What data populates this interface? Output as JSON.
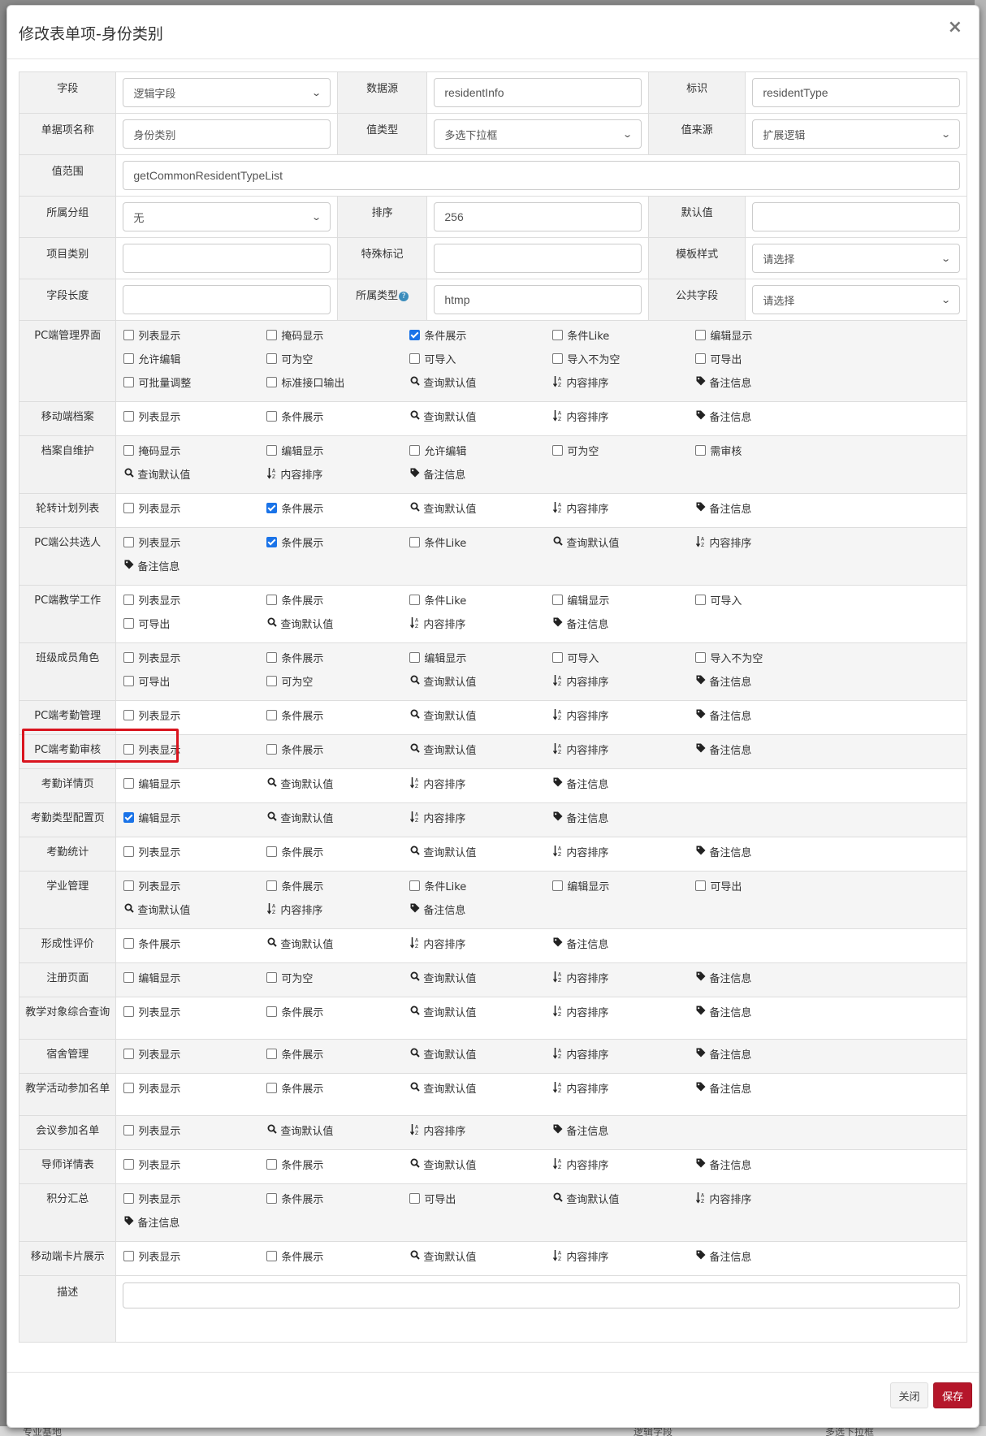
{
  "modal": {
    "title": "修改表单项-身份类别",
    "close_glyph": "×"
  },
  "form": {
    "field": {
      "label": "字段",
      "value": "逻辑字段"
    },
    "datasource": {
      "label": "数据源",
      "value": "residentInfo"
    },
    "identifier": {
      "label": "标识",
      "value": "residentType"
    },
    "item_name": {
      "label": "单据项名称",
      "value": "身份类别"
    },
    "value_type": {
      "label": "值类型",
      "value": "多选下拉框"
    },
    "value_source": {
      "label": "值来源",
      "value": "扩展逻辑"
    },
    "value_range": {
      "label": "值范围",
      "value": "getCommonResidentTypeList"
    },
    "group": {
      "label": "所属分组",
      "value": "无"
    },
    "sort": {
      "label": "排序",
      "value": "256"
    },
    "default": {
      "label": "默认值",
      "value": ""
    },
    "project_type": {
      "label": "项目类别",
      "value": ""
    },
    "special_mark": {
      "label": "特殊标记",
      "value": ""
    },
    "template_style": {
      "label": "模板样式",
      "value": "请选择"
    },
    "field_length": {
      "label": "字段长度",
      "value": ""
    },
    "belong_type": {
      "label": "所属类型",
      "value": "htmp",
      "help": "?"
    },
    "public_field": {
      "label": "公共字段",
      "value": "请选择"
    },
    "description": {
      "label": "描述",
      "value": ""
    }
  },
  "sections": [
    {
      "label": "PC端管理界面",
      "items": [
        {
          "type": "checkbox",
          "label": "列表显示",
          "checked": false
        },
        {
          "type": "checkbox",
          "label": "掩码显示",
          "checked": false
        },
        {
          "type": "checkbox",
          "label": "条件展示",
          "checked": true
        },
        {
          "type": "checkbox",
          "label": "条件Like",
          "checked": false
        },
        {
          "type": "checkbox",
          "label": "编辑显示",
          "checked": false
        },
        {
          "type": "checkbox",
          "label": "允许编辑",
          "checked": false
        },
        {
          "type": "checkbox",
          "label": "可为空",
          "checked": false
        },
        {
          "type": "checkbox",
          "label": "可导入",
          "checked": false
        },
        {
          "type": "checkbox",
          "label": "导入不为空",
          "checked": false
        },
        {
          "type": "checkbox",
          "label": "可导出",
          "checked": false
        },
        {
          "type": "checkbox",
          "label": "可批量调整",
          "checked": false
        },
        {
          "type": "checkbox",
          "label": "标准接口输出",
          "checked": false
        },
        {
          "type": "search",
          "label": "查询默认值"
        },
        {
          "type": "sort",
          "label": "内容排序"
        },
        {
          "type": "tag",
          "label": "备注信息"
        }
      ]
    },
    {
      "label": "移动端档案",
      "items": [
        {
          "type": "checkbox",
          "label": "列表显示",
          "checked": false
        },
        {
          "type": "checkbox",
          "label": "条件展示",
          "checked": false
        },
        {
          "type": "search",
          "label": "查询默认值"
        },
        {
          "type": "sort",
          "label": "内容排序"
        },
        {
          "type": "tag",
          "label": "备注信息"
        }
      ]
    },
    {
      "label": "档案自维护",
      "items": [
        {
          "type": "checkbox",
          "label": "掩码显示",
          "checked": false
        },
        {
          "type": "checkbox",
          "label": "编辑显示",
          "checked": false
        },
        {
          "type": "checkbox",
          "label": "允许编辑",
          "checked": false
        },
        {
          "type": "checkbox",
          "label": "可为空",
          "checked": false
        },
        {
          "type": "checkbox",
          "label": "需审核",
          "checked": false
        },
        {
          "type": "search",
          "label": "查询默认值"
        },
        {
          "type": "sort",
          "label": "内容排序"
        },
        {
          "type": "tag",
          "label": "备注信息"
        }
      ]
    },
    {
      "label": "轮转计划列表",
      "items": [
        {
          "type": "checkbox",
          "label": "列表显示",
          "checked": false
        },
        {
          "type": "checkbox",
          "label": "条件展示",
          "checked": true
        },
        {
          "type": "search",
          "label": "查询默认值"
        },
        {
          "type": "sort",
          "label": "内容排序"
        },
        {
          "type": "tag",
          "label": "备注信息"
        }
      ]
    },
    {
      "label": "PC端公共选人",
      "items": [
        {
          "type": "checkbox",
          "label": "列表显示",
          "checked": false
        },
        {
          "type": "checkbox",
          "label": "条件展示",
          "checked": true
        },
        {
          "type": "checkbox",
          "label": "条件Like",
          "checked": false
        },
        {
          "type": "search",
          "label": "查询默认值"
        },
        {
          "type": "sort",
          "label": "内容排序"
        },
        {
          "type": "tag",
          "label": "备注信息"
        }
      ]
    },
    {
      "label": "PC端教学工作",
      "items": [
        {
          "type": "checkbox",
          "label": "列表显示",
          "checked": false
        },
        {
          "type": "checkbox",
          "label": "条件展示",
          "checked": false
        },
        {
          "type": "checkbox",
          "label": "条件Like",
          "checked": false
        },
        {
          "type": "checkbox",
          "label": "编辑显示",
          "checked": false
        },
        {
          "type": "checkbox",
          "label": "可导入",
          "checked": false
        },
        {
          "type": "checkbox",
          "label": "可导出",
          "checked": false
        },
        {
          "type": "search",
          "label": "查询默认值"
        },
        {
          "type": "sort",
          "label": "内容排序"
        },
        {
          "type": "tag",
          "label": "备注信息"
        }
      ]
    },
    {
      "label": "班级成员角色",
      "items": [
        {
          "type": "checkbox",
          "label": "列表显示",
          "checked": false
        },
        {
          "type": "checkbox",
          "label": "条件展示",
          "checked": false
        },
        {
          "type": "checkbox",
          "label": "编辑显示",
          "checked": false
        },
        {
          "type": "checkbox",
          "label": "可导入",
          "checked": false
        },
        {
          "type": "checkbox",
          "label": "导入不为空",
          "checked": false
        },
        {
          "type": "checkbox",
          "label": "可导出",
          "checked": false
        },
        {
          "type": "checkbox",
          "label": "可为空",
          "checked": false
        },
        {
          "type": "search",
          "label": "查询默认值"
        },
        {
          "type": "sort",
          "label": "内容排序"
        },
        {
          "type": "tag",
          "label": "备注信息"
        }
      ]
    },
    {
      "label": "PC端考勤管理",
      "items": [
        {
          "type": "checkbox",
          "label": "列表显示",
          "checked": false
        },
        {
          "type": "checkbox",
          "label": "条件展示",
          "checked": false
        },
        {
          "type": "search",
          "label": "查询默认值"
        },
        {
          "type": "sort",
          "label": "内容排序"
        },
        {
          "type": "tag",
          "label": "备注信息"
        }
      ]
    },
    {
      "label": "PC端考勤审核",
      "items": [
        {
          "type": "checkbox",
          "label": "列表显示",
          "checked": false
        },
        {
          "type": "checkbox",
          "label": "条件展示",
          "checked": false
        },
        {
          "type": "search",
          "label": "查询默认值"
        },
        {
          "type": "sort",
          "label": "内容排序"
        },
        {
          "type": "tag",
          "label": "备注信息"
        }
      ]
    },
    {
      "label": "考勤详情页",
      "items": [
        {
          "type": "checkbox",
          "label": "编辑显示",
          "checked": false
        },
        {
          "type": "search",
          "label": "查询默认值"
        },
        {
          "type": "sort",
          "label": "内容排序"
        },
        {
          "type": "tag",
          "label": "备注信息"
        }
      ]
    },
    {
      "label": "考勤类型配置页",
      "highlight": true,
      "items": [
        {
          "type": "checkbox",
          "label": "编辑显示",
          "checked": true
        },
        {
          "type": "search",
          "label": "查询默认值"
        },
        {
          "type": "sort",
          "label": "内容排序"
        },
        {
          "type": "tag",
          "label": "备注信息"
        }
      ]
    },
    {
      "label": "考勤统计",
      "items": [
        {
          "type": "checkbox",
          "label": "列表显示",
          "checked": false
        },
        {
          "type": "checkbox",
          "label": "条件展示",
          "checked": false
        },
        {
          "type": "search",
          "label": "查询默认值"
        },
        {
          "type": "sort",
          "label": "内容排序"
        },
        {
          "type": "tag",
          "label": "备注信息"
        }
      ]
    },
    {
      "label": "学业管理",
      "items": [
        {
          "type": "checkbox",
          "label": "列表显示",
          "checked": false
        },
        {
          "type": "checkbox",
          "label": "条件展示",
          "checked": false
        },
        {
          "type": "checkbox",
          "label": "条件Like",
          "checked": false
        },
        {
          "type": "checkbox",
          "label": "编辑显示",
          "checked": false
        },
        {
          "type": "checkbox",
          "label": "可导出",
          "checked": false
        },
        {
          "type": "search",
          "label": "查询默认值"
        },
        {
          "type": "sort",
          "label": "内容排序"
        },
        {
          "type": "tag",
          "label": "备注信息"
        }
      ]
    },
    {
      "label": "形成性评价",
      "items": [
        {
          "type": "checkbox",
          "label": "条件展示",
          "checked": false
        },
        {
          "type": "search",
          "label": "查询默认值"
        },
        {
          "type": "sort",
          "label": "内容排序"
        },
        {
          "type": "tag",
          "label": "备注信息"
        }
      ]
    },
    {
      "label": "注册页面",
      "items": [
        {
          "type": "checkbox",
          "label": "编辑显示",
          "checked": false
        },
        {
          "type": "checkbox",
          "label": "可为空",
          "checked": false
        },
        {
          "type": "search",
          "label": "查询默认值"
        },
        {
          "type": "sort",
          "label": "内容排序"
        },
        {
          "type": "tag",
          "label": "备注信息"
        }
      ]
    },
    {
      "label": "教学对象综合查询",
      "items": [
        {
          "type": "checkbox",
          "label": "列表显示",
          "checked": false
        },
        {
          "type": "checkbox",
          "label": "条件展示",
          "checked": false
        },
        {
          "type": "search",
          "label": "查询默认值"
        },
        {
          "type": "sort",
          "label": "内容排序"
        },
        {
          "type": "tag",
          "label": "备注信息"
        }
      ]
    },
    {
      "label": "宿舍管理",
      "items": [
        {
          "type": "checkbox",
          "label": "列表显示",
          "checked": false
        },
        {
          "type": "checkbox",
          "label": "条件展示",
          "checked": false
        },
        {
          "type": "search",
          "label": "查询默认值"
        },
        {
          "type": "sort",
          "label": "内容排序"
        },
        {
          "type": "tag",
          "label": "备注信息"
        }
      ]
    },
    {
      "label": "教学活动参加名单",
      "items": [
        {
          "type": "checkbox",
          "label": "列表显示",
          "checked": false
        },
        {
          "type": "checkbox",
          "label": "条件展示",
          "checked": false
        },
        {
          "type": "search",
          "label": "查询默认值"
        },
        {
          "type": "sort",
          "label": "内容排序"
        },
        {
          "type": "tag",
          "label": "备注信息"
        }
      ]
    },
    {
      "label": "会议参加名单",
      "items": [
        {
          "type": "checkbox",
          "label": "列表显示",
          "checked": false
        },
        {
          "type": "search",
          "label": "查询默认值"
        },
        {
          "type": "sort",
          "label": "内容排序"
        },
        {
          "type": "tag",
          "label": "备注信息"
        }
      ]
    },
    {
      "label": "导师详情表",
      "items": [
        {
          "type": "checkbox",
          "label": "列表显示",
          "checked": false
        },
        {
          "type": "checkbox",
          "label": "条件展示",
          "checked": false
        },
        {
          "type": "search",
          "label": "查询默认值"
        },
        {
          "type": "sort",
          "label": "内容排序"
        },
        {
          "type": "tag",
          "label": "备注信息"
        }
      ]
    },
    {
      "label": "积分汇总",
      "items": [
        {
          "type": "checkbox",
          "label": "列表显示",
          "checked": false
        },
        {
          "type": "checkbox",
          "label": "条件展示",
          "checked": false
        },
        {
          "type": "checkbox",
          "label": "可导出",
          "checked": false
        },
        {
          "type": "search",
          "label": "查询默认值"
        },
        {
          "type": "sort",
          "label": "内容排序"
        },
        {
          "type": "tag",
          "label": "备注信息"
        }
      ]
    },
    {
      "label": "移动端卡片展示",
      "items": [
        {
          "type": "checkbox",
          "label": "列表显示",
          "checked": false
        },
        {
          "type": "checkbox",
          "label": "条件展示",
          "checked": false
        },
        {
          "type": "search",
          "label": "查询默认值"
        },
        {
          "type": "sort",
          "label": "内容排序"
        },
        {
          "type": "tag",
          "label": "备注信息"
        }
      ]
    }
  ],
  "footer": {
    "close_label": "关闭",
    "save_label": "保存"
  },
  "background": {
    "partial_left": "专业基地",
    "partial_mid": "逻辑字段",
    "partial_right": "多选下拉框"
  },
  "colors": {
    "save_button": "#b5162a",
    "checkbox_checked": "#1a73e8",
    "highlight_box": "#d9141e"
  },
  "icons": {
    "search": "search-icon",
    "sort": "sort-alpha-icon",
    "tag": "tag-icon",
    "help": "question-circle-icon"
  }
}
